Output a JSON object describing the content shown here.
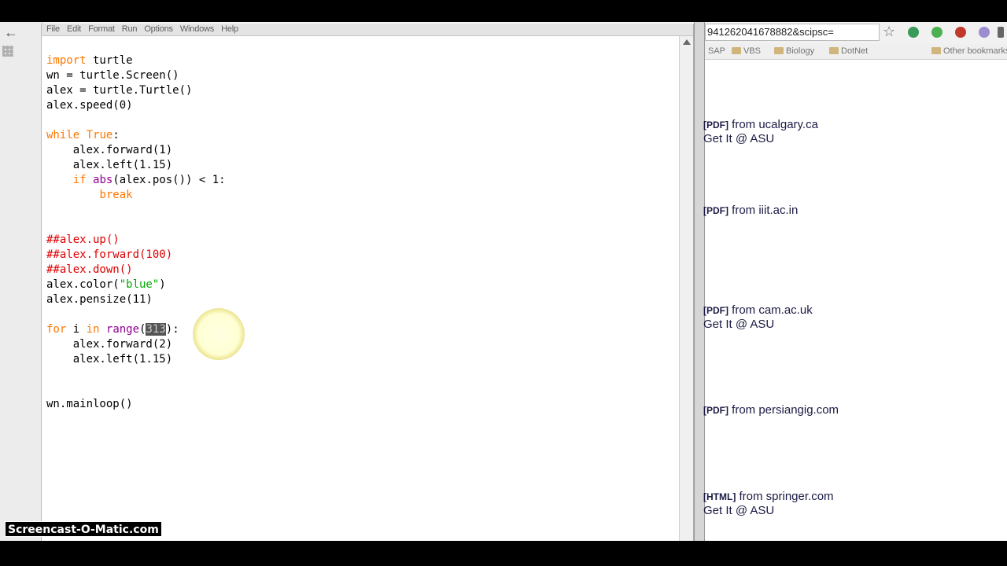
{
  "editor": {
    "menu": [
      "File",
      "Edit",
      "Format",
      "Run",
      "Options",
      "Windows",
      "Help"
    ],
    "code": {
      "l1_kw": "import",
      "l1_rest": " turtle",
      "l2": "wn = turtle.Screen()",
      "l3": "alex = turtle.Turtle()",
      "l4": "alex.speed(0)",
      "l6_kw": "while",
      "l6_mid": " ",
      "l6_kw2": "True",
      "l6_end": ":",
      "l7": "    alex.forward(1)",
      "l8": "    alex.left(1.15)",
      "l9_pad": "    ",
      "l9_kw": "if",
      "l9_sp": " ",
      "l9_bi": "abs",
      "l9_rest": "(alex.pos()) < 1:",
      "l10_pad": "        ",
      "l10_kw": "break",
      "l13": "##alex.up()",
      "l14": "##alex.forward(100)",
      "l15": "##alex.down()",
      "l16_a": "alex.color(",
      "l16_str": "\"blue\"",
      "l16_b": ")",
      "l17": "alex.pensize(11)",
      "l19_kw": "for",
      "l19_a": " i ",
      "l19_kw2": "in",
      "l19_sp": " ",
      "l19_bi": "range",
      "l19_p": "(",
      "l19_sel": "313",
      "l19_end": "):",
      "l20": "    alex.forward(2)",
      "l21": "    alex.left(1.15)",
      "l24": "wn.mainloop()"
    }
  },
  "browser": {
    "url": "941262041678882&scipsc=",
    "bookmarks": [
      "SAP",
      "VBS",
      "Biology",
      "DotNet",
      "Other bookmarks"
    ],
    "results": [
      {
        "tag": "[PDF]",
        "text": " from ucalgary.ca",
        "getit": "Get It @ ASU"
      },
      {
        "tag": "[PDF]",
        "text": " from iiit.ac.in"
      },
      {
        "tag": "[PDF]",
        "text": " from cam.ac.uk",
        "getit": "Get It @ ASU"
      },
      {
        "tag": "[PDF]",
        "text": " from persiangig.com"
      },
      {
        "tag": "[HTML]",
        "text": " from springer.com",
        "getit": "Get It @ ASU"
      }
    ]
  },
  "watermark": "Screencast-O-Matic.com",
  "colors": {
    "keyword": "#ff7700",
    "comment": "#dd0000",
    "string": "#00aa00",
    "builtin": "#900090",
    "link": "#1a1a44"
  },
  "icons": {
    "star": "bookmark-star-icon",
    "back": "back-arrow-icon"
  }
}
